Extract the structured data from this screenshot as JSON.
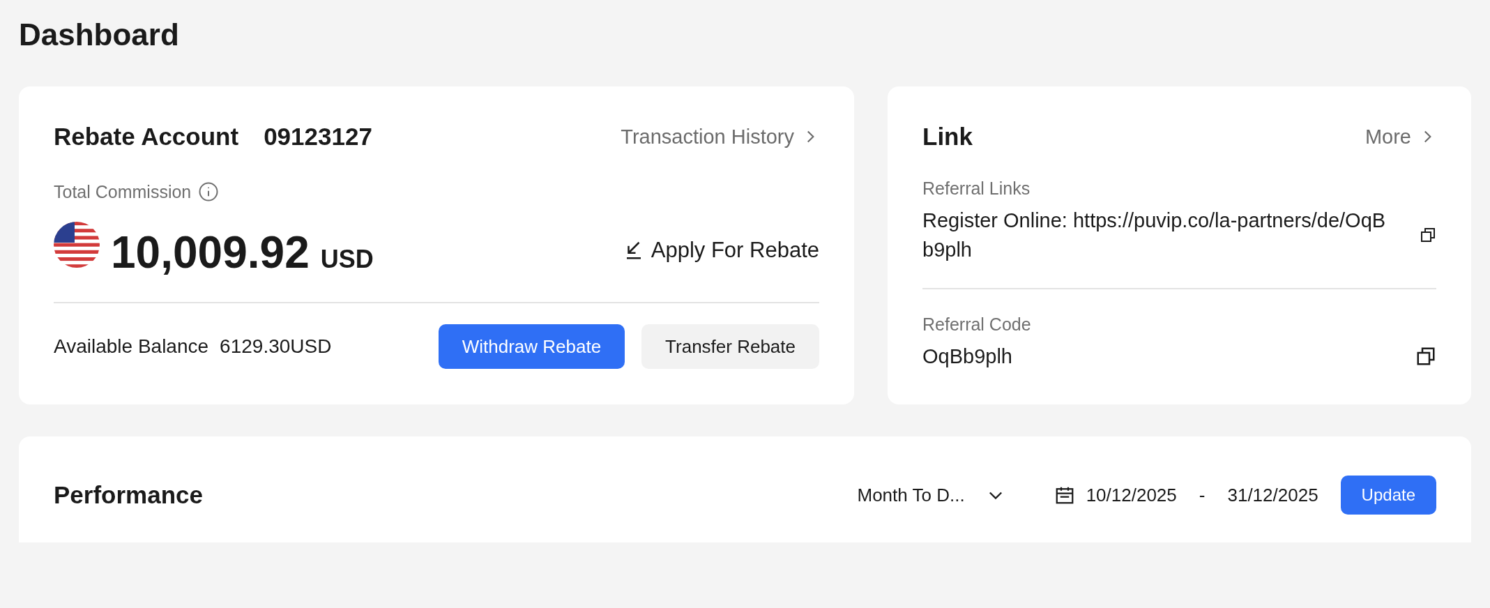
{
  "page_title": "Dashboard",
  "rebate_account": {
    "title": "Rebate Account",
    "account_number": "09123127",
    "history_link": "Transaction History",
    "total_label": "Total Commission",
    "amount": "10,009.92",
    "currency": "USD",
    "apply_link": "Apply For Rebate",
    "balance_label": "Available Balance",
    "balance_value": "6129.30USD",
    "buttons": [
      {
        "label": "Withdraw Rebate",
        "kind": "primary"
      },
      {
        "label": "Transfer Rebate",
        "kind": "secondary"
      }
    ]
  },
  "link": {
    "title": "Link",
    "more_link": "More",
    "sections": [
      {
        "label": "Referral Links",
        "value": "Register Online: https://puvip.co/la-partners/de/OqBb9plh"
      },
      {
        "label": "Referral Code",
        "value": "OqBb9plh"
      }
    ]
  },
  "performance": {
    "title": "Performance",
    "period": "Month To D...",
    "date_from": "10/12/2025",
    "separator": "-",
    "date_to": "31/12/2025",
    "update_button": "Update"
  }
}
